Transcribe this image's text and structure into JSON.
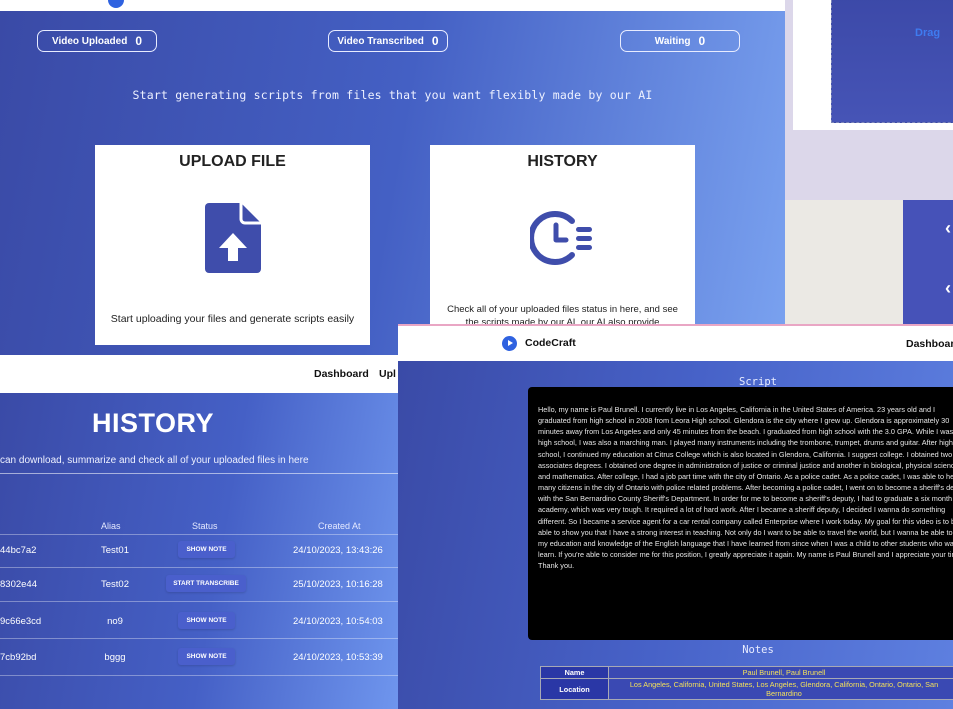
{
  "dashboard": {
    "stats": [
      {
        "label": "Video Uploaded",
        "value": "0"
      },
      {
        "label": "Video Transcribed",
        "value": "0"
      },
      {
        "label": "Waiting",
        "value": "0"
      }
    ],
    "tagline": "Start generating scripts from files that you want flexibly made by our AI",
    "upload_card": {
      "title": "UPLOAD FILE",
      "description": "Start uploading your files and generate scripts easily"
    },
    "history_card": {
      "title": "HISTORY",
      "description": "Check all of your uploaded files status in here, and see the scripts made by our AI. our AI also provide summarized"
    }
  },
  "drop_window": {
    "drag_text": "Drag"
  },
  "history": {
    "nav": {
      "dashboard": "Dashboard",
      "upload": "Upl"
    },
    "title": "HISTORY",
    "subtitle": "can download, summarize and check all of your uploaded files in here",
    "columns": [
      "Alias",
      "Status",
      "Created At"
    ],
    "rows": [
      {
        "hash": "44bc7a2",
        "alias": "Test01",
        "status": "SHOW NOTE",
        "created": "24/10/2023, 13:43:26"
      },
      {
        "hash": "8302e44",
        "alias": "Test02",
        "status": "START TRANSCRIBE",
        "created": "25/10/2023, 10:16:28"
      },
      {
        "hash": "9c66e3cd",
        "alias": "no9",
        "status": "SHOW NOTE",
        "created": "24/10/2023, 10:54:03"
      },
      {
        "hash": "7cb92bd",
        "alias": "bggg",
        "status": "SHOW NOTE",
        "created": "24/10/2023, 10:53:39"
      }
    ]
  },
  "script_page": {
    "brand": "CodeCraft",
    "nav_dashboard": "Dashboard",
    "script_title": "Script",
    "script_text": "Hello, my name is Paul Brunell. I currently live in Los Angeles, California in the United States of America. 23 years old and I graduated from high school in 2008 from Leora High school. Glendora is the city where I grew up. Glendora is approximately 30 minutes away from Los Angeles and only 45 minutes from the beach. I graduated from high school with the 3.0 GPA. While I was in high school, I was also a marching man. I played many instruments including the trombone, trumpet, drums and guitar. After high school, I continued my education at Citrus College which is also located in Glendora, California. I suggest college. I obtained two associates degrees. I obtained one degree in administration of justice or criminal justice and another in biological, physical sciences and mathematics. After college, I had a job part time with the city of Ontario. As a police cadet. As a police cadet, I was able to help many citizens in the city of Ontario with police related problems. After becoming a police cadet, I went on to become a sheriff's deputy with the San Bernardino County Sheriff's Department. In order for me to become a sheriff's deputy, I had to graduate a six month long academy, which was very tough. It required a lot of hard work. After I became a sheriff deputy, I decided I wanna do something different. So I became a service agent for a car rental company called Enterprise where I work today. My goal for this video is to be able to show you that I have a strong interest in teaching. Not only do I want to be able to travel the world, but I wanna be able to use my education and knowledge of the English language that I have learned from since when I was a child to other students who want to learn. If you're able to consider me for this position, I greatly appreciate it again. My name is Paul Brunell and I appreciate your time. Thank you.",
    "notes_title": "Notes",
    "notes": [
      {
        "key": "Name",
        "value": "Paul Brunell, Paul Brunell"
      },
      {
        "key": "Location",
        "value": "Los Angeles, California, United States, Los Angeles, Glendora, California, Ontario, Ontario, San Bernardino"
      }
    ]
  },
  "icons": {
    "upload": "file-upload-icon",
    "history": "clock-history-icon",
    "logo": "play-logo-icon"
  },
  "colors": {
    "accent_blue": "#3f51b5",
    "icon_blue": "#3f4dab",
    "notes_value_yellow": "#f4e15a"
  }
}
